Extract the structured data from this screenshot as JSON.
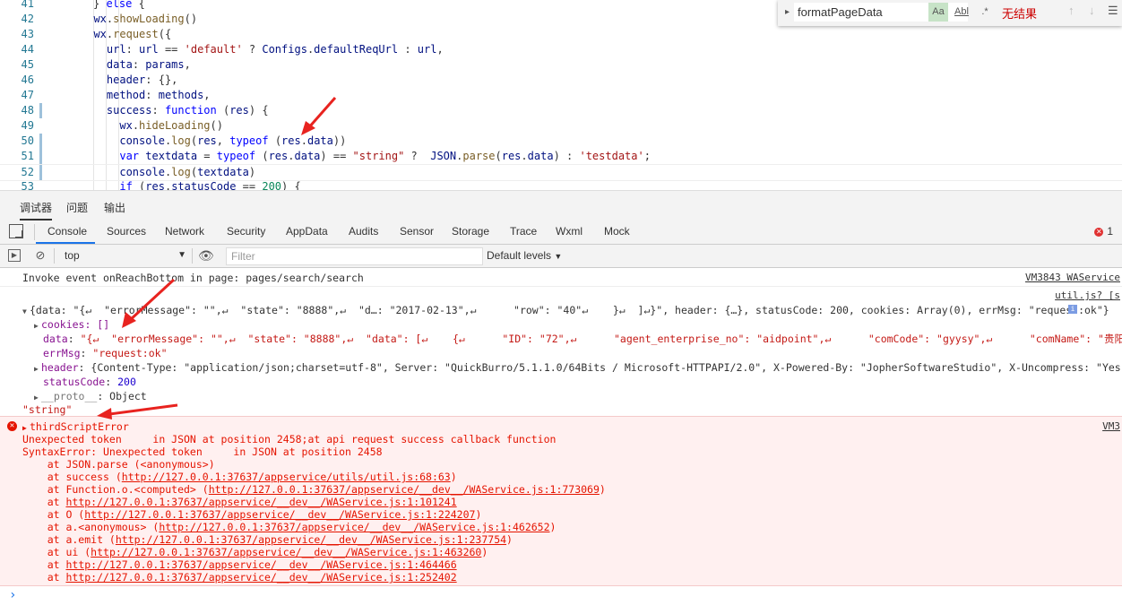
{
  "editor": {
    "lines": [
      {
        "num": "41",
        "html": "<span style='color:#333'>} </span><span class='tk-kw'>else</span> {"
      },
      {
        "num": "42",
        "html": "  <span class='tk-var'>wx</span>.<span class='tk-fn'>showLoading</span>()"
      },
      {
        "num": "43",
        "html": "  <span class='tk-var'>wx</span>.<span class='tk-fn'>request</span>({"
      },
      {
        "num": "44",
        "html": "    <span class='tk-var'>url</span>: <span class='tk-var'>url</span> == <span class='tk-str'>'default'</span> ? <span class='tk-var'>Configs</span>.<span class='tk-var'>defaultReqUrl</span> : <span class='tk-var'>url</span>,"
      },
      {
        "num": "45",
        "html": "    <span class='tk-var'>data</span>: <span class='tk-var'>params</span>,"
      },
      {
        "num": "46",
        "html": "    <span class='tk-var'>header</span>: {},"
      },
      {
        "num": "47",
        "html": "    <span class='tk-var'>method</span>: <span class='tk-var'>methods</span>,"
      },
      {
        "num": "48",
        "html": "    <span class='tk-var'>success</span>: <span class='tk-kw'>function</span> (<span class='tk-var'>res</span>) {"
      },
      {
        "num": "49",
        "html": "      <span class='tk-var'>wx</span>.<span class='tk-fn'>hideLoading</span>()"
      },
      {
        "num": "50",
        "html": "      <span class='tk-var'>console</span>.<span class='tk-fn'>log</span>(<span class='tk-var'>res</span>, <span class='tk-kw'>typeof</span> (<span class='tk-var'>res</span>.<span class='tk-var'>data</span>))"
      },
      {
        "num": "51",
        "html": "      <span class='tk-kw'>var</span> <span class='tk-var'>textdata</span> = <span class='tk-kw'>typeof</span> (<span class='tk-var'>res</span>.<span class='tk-var'>data</span>) == <span class='tk-str'>\"string\"</span> ?  <span class='tk-var'>JSON</span>.<span class='tk-fn'>parse</span>(<span class='tk-var'>res</span>.<span class='tk-var'>data</span>) : <span class='tk-str'>'testdata'</span>;"
      },
      {
        "num": "52",
        "html": "      <span class='tk-var'>console</span>.<span class='tk-fn'>log</span>(<span class='tk-var'>textdata</span>)"
      },
      {
        "num": "53",
        "html": "      <span class='tk-kw'>if</span> (<span class='tk-var'>res</span>.<span class='tk-var'>statusCode</span> == <span class='tk-num'>200</span>) {"
      }
    ],
    "find": {
      "query": "formatPageData",
      "match_case": "Aa",
      "whole_word": "Abl",
      "regex": ".*",
      "result": "无结果"
    }
  },
  "panel_tabs": [
    "调试器",
    "问题",
    "输出"
  ],
  "devtools_tabs": [
    "Console",
    "Sources",
    "Network",
    "Security",
    "AppData",
    "Audits",
    "Sensor",
    "Storage",
    "Trace",
    "Wxml",
    "Mock"
  ],
  "error_count": "1",
  "toolbar": {
    "context": "top",
    "filter_placeholder": "Filter",
    "levels": "Default levels"
  },
  "console": {
    "invoke_msg": "Invoke event onReachBottom in page: pages/search/search",
    "invoke_src": "VM3843 WAService",
    "util_src": "util.js? [s",
    "res_summary": "{data: \"{↵  \"errorMessage\": \"\",↵  \"state\": \"8888\",↵  \"d…: \"2017-02-13\",↵      \"row\": \"40\"↵    }↵  ]↵}\", header: {…}, statusCode: 200, cookies: Array(0), errMsg: \"request:ok\"}",
    "cookies": "cookies: []",
    "data_key": "data",
    "data_val": "\"{↵  \"errorMessage\": \"\",↵  \"state\": \"8888\",↵  \"data\": [↵    {↵      \"ID\": \"72\",↵      \"agent_enterprise_no\": \"aidpoint\",↵      \"comCode\": \"gyysy\",↵      \"comName\": \"贵阳杨胜远\",",
    "errmsg_key": "errMsg",
    "errmsg_val": "\"request:ok\"",
    "header_key": "header",
    "header_val": "{Content-Type: \"application/json;charset=utf-8\", Server: \"QuickBurro/5.1.1.0/64Bits / Microsoft-HTTPAPI/2.0\", X-Powered-By: \"JopherSoftwareStudio\", X-Uncompress: \"Yes\", Access",
    "status_key": "statusCode",
    "status_val": "200",
    "proto_key": "__proto__",
    "proto_val": "Object",
    "typeof_out": "\"string\"",
    "error": {
      "title": "thirdScriptError",
      "src": "VM3",
      "line1": "Unexpected token     in JSON at position 2458;at api request success callback function",
      "line2": "SyntaxError: Unexpected token     in JSON at position 2458",
      "stack": [
        {
          "pre": "    at JSON.parse (<anonymous>)",
          "link": "",
          "post": ""
        },
        {
          "pre": "    at success (",
          "link": "http://127.0.0.1:37637/appservice/utils/util.js:68:63",
          "post": ")"
        },
        {
          "pre": "    at Function.o.<computed> (",
          "link": "http://127.0.0.1:37637/appservice/__dev__/WAService.js:1:773069",
          "post": ")"
        },
        {
          "pre": "    at ",
          "link": "http://127.0.0.1:37637/appservice/__dev__/WAService.js:1:101241",
          "post": ""
        },
        {
          "pre": "    at O (",
          "link": "http://127.0.0.1:37637/appservice/__dev__/WAService.js:1:224207",
          "post": ")"
        },
        {
          "pre": "    at a.<anonymous> (",
          "link": "http://127.0.0.1:37637/appservice/__dev__/WAService.js:1:462652",
          "post": ")"
        },
        {
          "pre": "    at a.emit (",
          "link": "http://127.0.0.1:37637/appservice/__dev__/WAService.js:1:237754",
          "post": ")"
        },
        {
          "pre": "    at ui (",
          "link": "http://127.0.0.1:37637/appservice/__dev__/WAService.js:1:463260",
          "post": ")"
        },
        {
          "pre": "    at ",
          "link": "http://127.0.0.1:37637/appservice/__dev__/WAService.js:1:464466",
          "post": ""
        },
        {
          "pre": "    at ",
          "link": "http://127.0.0.1:37637/appservice/__dev__/WAService.js:1:252402",
          "post": ""
        }
      ]
    },
    "prompt": "›"
  },
  "colors": {
    "accent": "#1a73e8",
    "error": "#e51400",
    "arrow": "#e8231f"
  }
}
